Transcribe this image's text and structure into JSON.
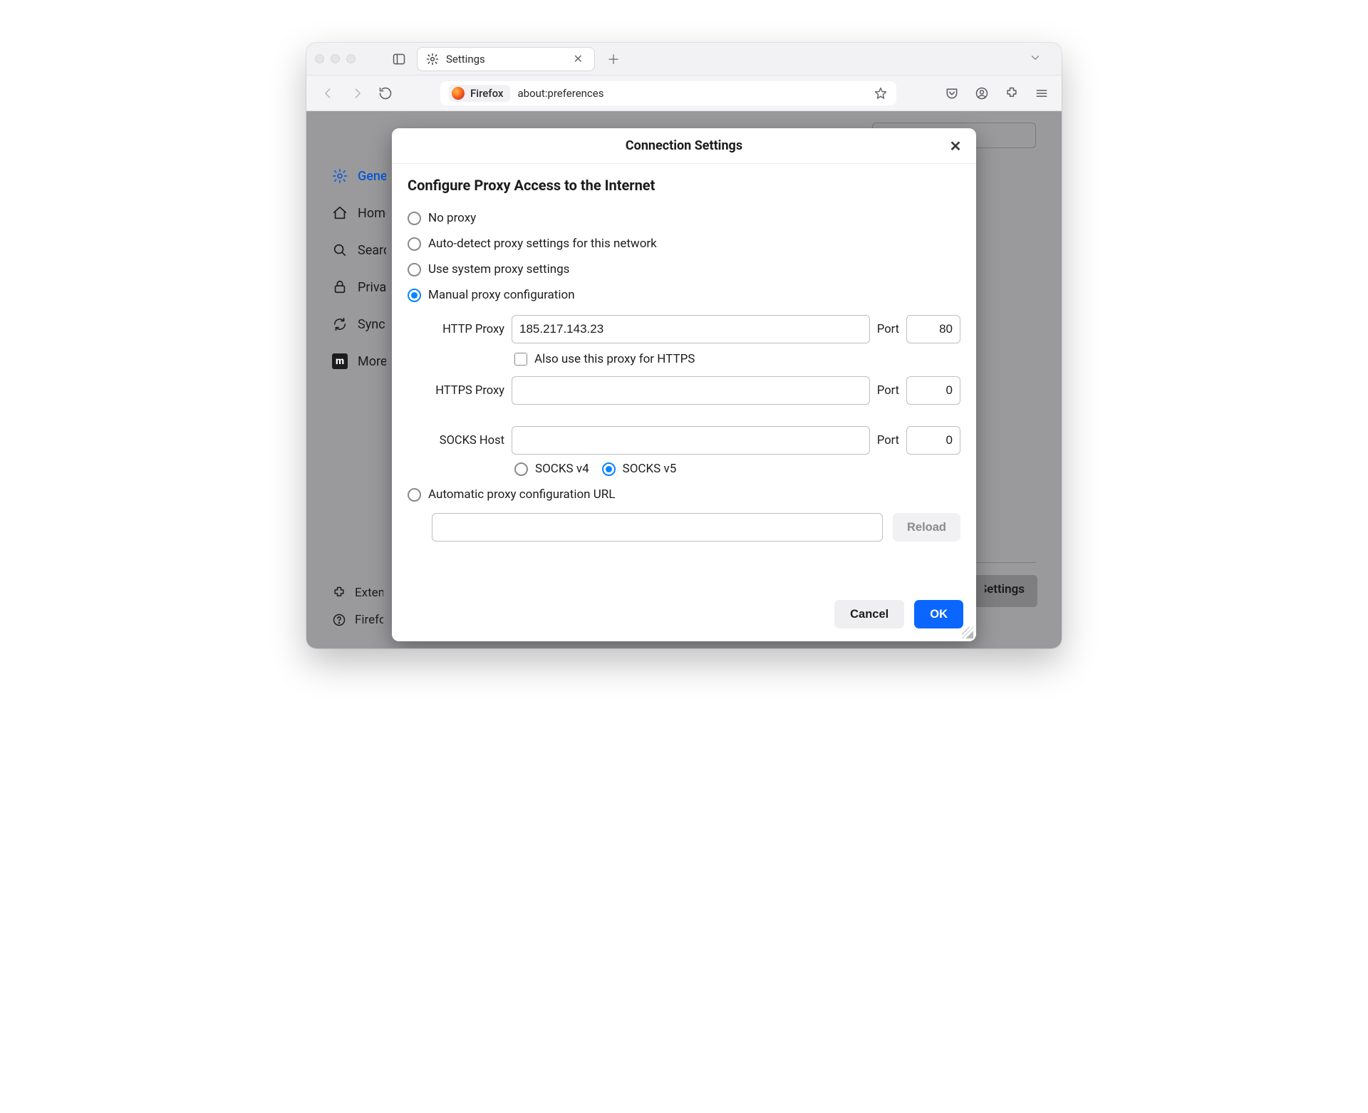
{
  "tab": {
    "title": "Settings"
  },
  "urlbar": {
    "identity": "Firefox",
    "url": "about:preferences"
  },
  "sidebar": {
    "items": [
      {
        "label": "General"
      },
      {
        "label": "Home"
      },
      {
        "label": "Search"
      },
      {
        "label": "Privacy & Security"
      },
      {
        "label": "Sync"
      },
      {
        "label": "More from Mozilla"
      }
    ],
    "footer": [
      {
        "label": "Extensions & Themes"
      },
      {
        "label": "Firefox Support"
      }
    ]
  },
  "bgButton": "Settings...",
  "dialog": {
    "title": "Connection Settings",
    "sectionTitle": "Configure Proxy Access to the Internet",
    "options": {
      "none": "No proxy",
      "auto": "Auto-detect proxy settings for this network",
      "system": "Use system proxy settings",
      "manual": "Manual proxy configuration",
      "pac": "Automatic proxy configuration URL"
    },
    "labels": {
      "httpProxy": "HTTP Proxy",
      "httpsProxy": "HTTPS Proxy",
      "socksHost": "SOCKS Host",
      "port": "Port",
      "alsoHttps": "Also use this proxy for HTTPS",
      "socksv4": "SOCKS v4",
      "socksv5": "SOCKS v5"
    },
    "values": {
      "httpHost": "185.217.143.23",
      "httpPort": "80",
      "httpsHost": "",
      "httpsPort": "0",
      "socksHost": "",
      "socksPort": "0",
      "pacUrl": ""
    },
    "buttons": {
      "reload": "Reload",
      "cancel": "Cancel",
      "ok": "OK"
    }
  }
}
